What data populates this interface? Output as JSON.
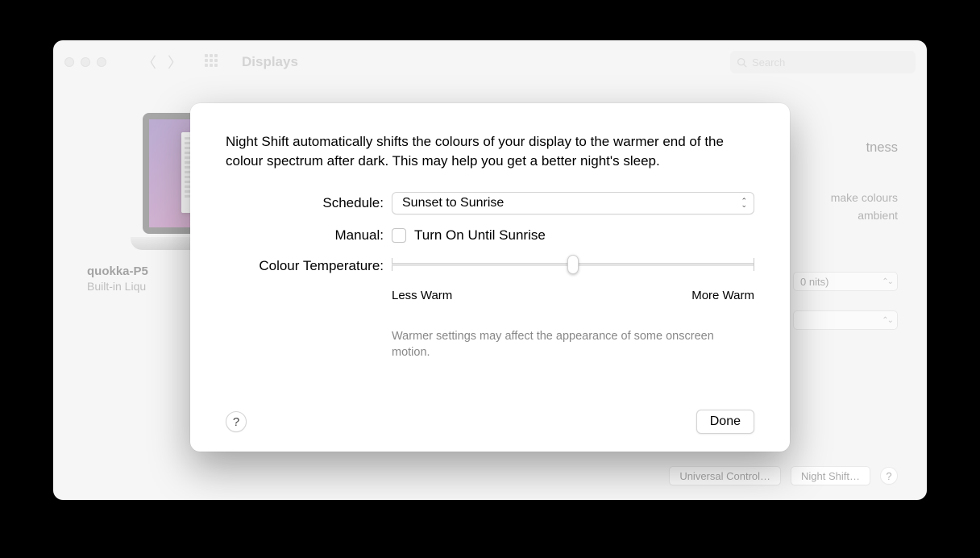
{
  "window": {
    "title": "Displays",
    "search_placeholder": "Search"
  },
  "display": {
    "name": "quokka-P5",
    "subtitle": "Built-in Liqu"
  },
  "bg_panel": {
    "brightness_partial": "tness",
    "truetone_line1": "make colours",
    "truetone_line2": "ambient",
    "preset_partial": "0 nits)",
    "universal_btn": "Universal Control…",
    "nightshift_btn": "Night Shift…"
  },
  "sheet": {
    "description": "Night Shift automatically shifts the colours of your display to the warmer end of the colour spectrum after dark. This may help you get a better night's sleep.",
    "schedule_label": "Schedule:",
    "schedule_value": "Sunset to Sunrise",
    "manual_label": "Manual:",
    "manual_checkbox_label": "Turn On Until Sunrise",
    "manual_checked": false,
    "temp_label": "Colour Temperature:",
    "slider_min_label": "Less Warm",
    "slider_max_label": "More Warm",
    "slider_percent": 50,
    "hint": "Warmer settings may affect the appearance of some onscreen motion.",
    "done": "Done"
  }
}
